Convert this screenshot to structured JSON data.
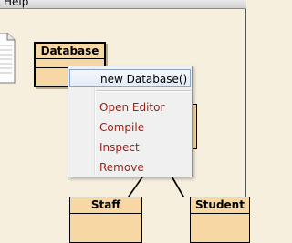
{
  "menubar": {
    "help_label": "Help"
  },
  "diagram": {
    "classes": {
      "database": "Database",
      "staff": "Staff",
      "student": "Student"
    }
  },
  "context_menu": {
    "items": [
      {
        "label": "new Database()",
        "kind": "constructor"
      },
      {
        "label": "Open Editor",
        "kind": "action"
      },
      {
        "label": "Compile",
        "kind": "action"
      },
      {
        "label": "Inspect",
        "kind": "action"
      },
      {
        "label": "Remove",
        "kind": "action"
      }
    ]
  },
  "colors": {
    "canvas": "#f6efdd",
    "class_fill": "#f7d8a5",
    "action_text": "#9c1f16"
  }
}
